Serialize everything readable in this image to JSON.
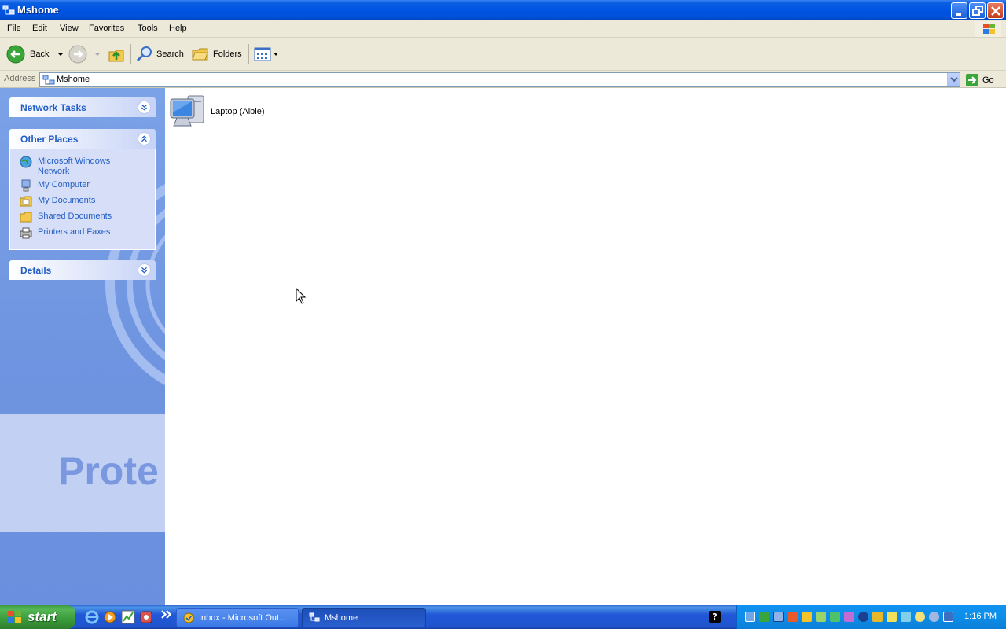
{
  "window": {
    "title": "Mshome"
  },
  "menu": [
    "File",
    "Edit",
    "View",
    "Favorites",
    "Tools",
    "Help"
  ],
  "toolbar": {
    "back": "Back",
    "search": "Search",
    "folders": "Folders"
  },
  "address": {
    "label": "Address",
    "value": "Mshome",
    "go": "Go"
  },
  "sidebar": {
    "network_tasks": "Network Tasks",
    "other_places": "Other Places",
    "places": [
      {
        "label": "Microsoft Windows Network",
        "icon": "network-globe-icon"
      },
      {
        "label": "My Computer",
        "icon": "my-computer-icon"
      },
      {
        "label": "My Documents",
        "icon": "my-documents-icon"
      },
      {
        "label": "Shared Documents",
        "icon": "folder-icon"
      },
      {
        "label": "Printers and Faxes",
        "icon": "printer-icon"
      }
    ],
    "details": "Details",
    "background_text": "Prote"
  },
  "content": {
    "items": [
      {
        "label": "Laptop (Albie)",
        "icon": "computer-icon"
      }
    ]
  },
  "taskbar": {
    "start": "start",
    "tasks": [
      {
        "label": "Inbox - Microsoft Out...",
        "active": false
      },
      {
        "label": "Mshome",
        "active": true
      }
    ],
    "clock": "1:16 PM"
  },
  "colors": {
    "title_bar": "#0054e3",
    "link": "#215dc6",
    "start_green": "#3a9a3a",
    "task_pane": "#6f95e1"
  }
}
